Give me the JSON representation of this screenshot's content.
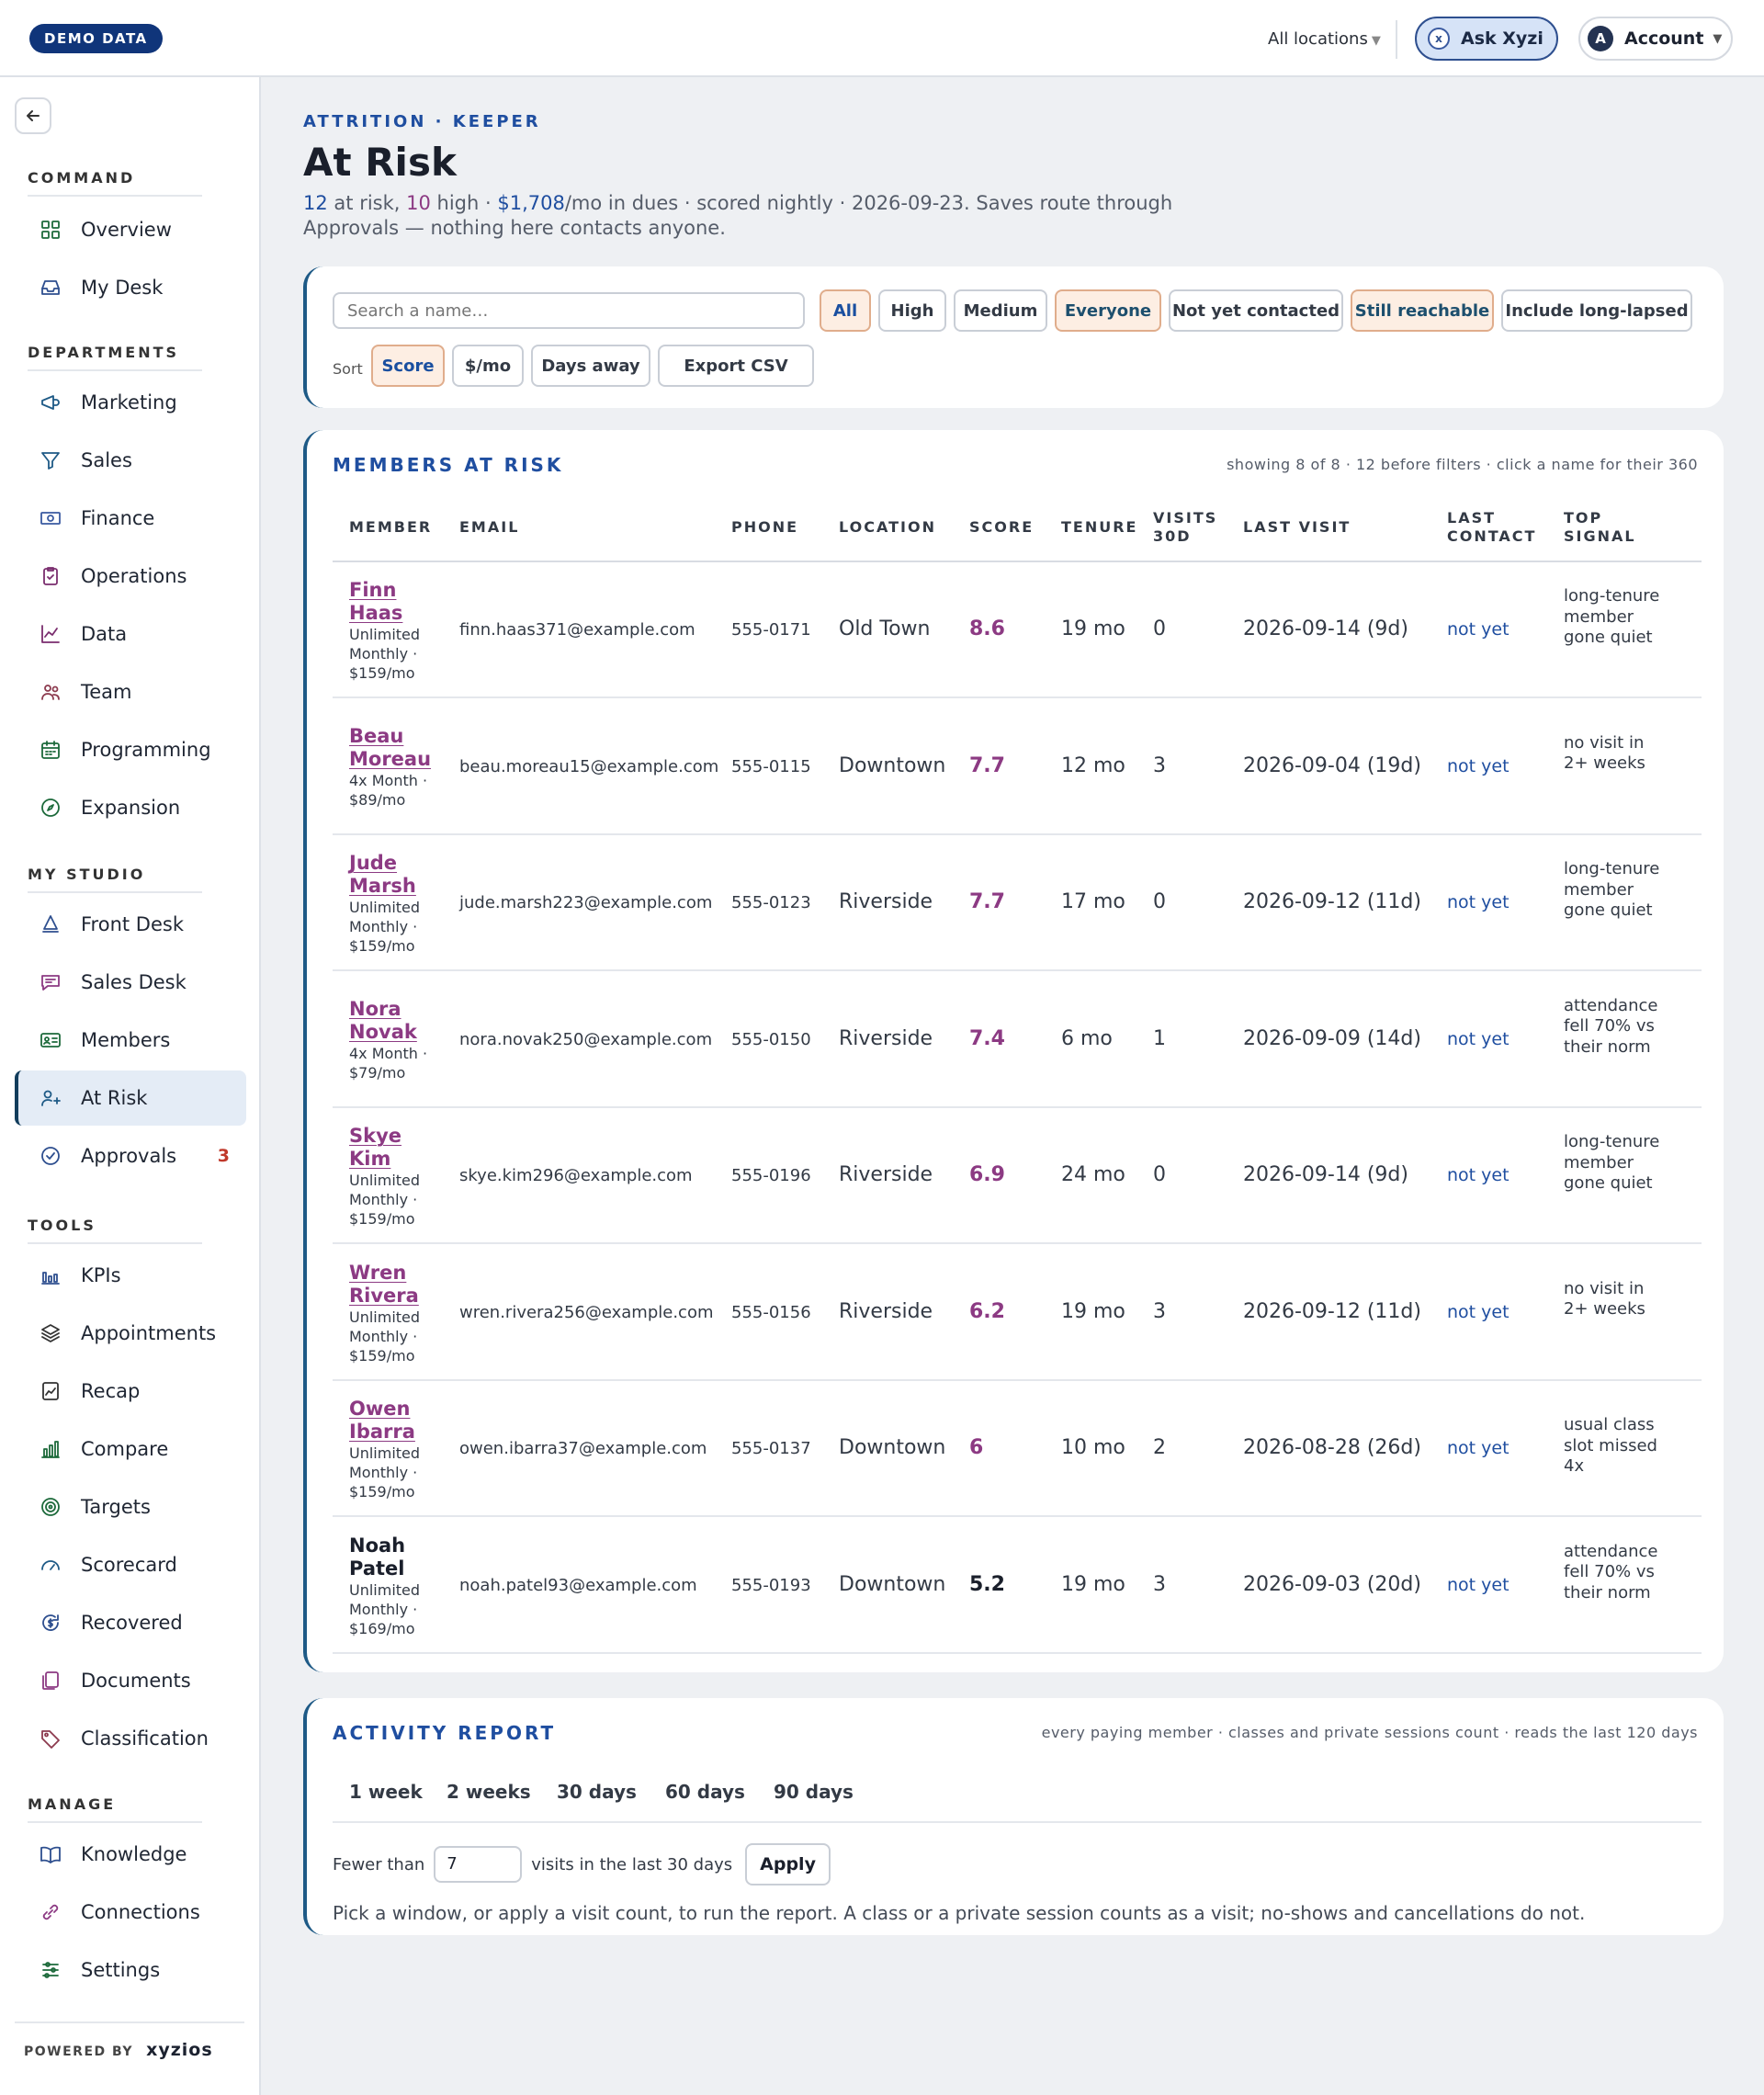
{
  "topbar": {
    "demo_badge": "DEMO DATA",
    "location_select": "All locations",
    "ask_label": "Ask Xyzi",
    "account_initial": "A",
    "account_label": "Account"
  },
  "sidebar": {
    "sections": [
      {
        "label": "COMMAND",
        "items": [
          {
            "label": "Overview",
            "icon": "grid-icon"
          },
          {
            "label": "My Desk",
            "icon": "inbox-icon"
          }
        ]
      },
      {
        "label": "DEPARTMENTS",
        "items": [
          {
            "label": "Marketing",
            "icon": "megaphone-icon"
          },
          {
            "label": "Sales",
            "icon": "funnel-icon"
          },
          {
            "label": "Finance",
            "icon": "banknote-icon"
          },
          {
            "label": "Operations",
            "icon": "clipboard-check-icon"
          },
          {
            "label": "Data",
            "icon": "line-chart-icon"
          },
          {
            "label": "Team",
            "icon": "users-icon"
          },
          {
            "label": "Programming",
            "icon": "calendar-icon"
          },
          {
            "label": "Expansion",
            "icon": "compass-icon"
          }
        ]
      },
      {
        "label": "MY STUDIO",
        "items": [
          {
            "label": "Front Desk",
            "icon": "bell-icon"
          },
          {
            "label": "Sales Desk",
            "icon": "message-icon"
          },
          {
            "label": "Members",
            "icon": "id-card-icon"
          },
          {
            "label": "At Risk",
            "icon": "user-alert-icon",
            "active": true
          },
          {
            "label": "Approvals",
            "icon": "check-circle-icon",
            "badge": "3"
          }
        ]
      },
      {
        "label": "TOOLS",
        "items": [
          {
            "label": "KPIs",
            "icon": "bar-chart-icon"
          },
          {
            "label": "Appointments",
            "icon": "layers-icon"
          },
          {
            "label": "Recap",
            "icon": "trend-doc-icon"
          },
          {
            "label": "Compare",
            "icon": "columns-chart-icon"
          },
          {
            "label": "Targets",
            "icon": "target-icon"
          },
          {
            "label": "Scorecard",
            "icon": "gauge-icon"
          },
          {
            "label": "Recovered",
            "icon": "refresh-dollar-icon"
          },
          {
            "label": "Documents",
            "icon": "documents-icon"
          },
          {
            "label": "Classification",
            "icon": "tag-icon"
          }
        ]
      },
      {
        "label": "MANAGE",
        "items": [
          {
            "label": "Knowledge",
            "icon": "book-icon"
          },
          {
            "label": "Connections",
            "icon": "link-icon"
          },
          {
            "label": "Settings",
            "icon": "sliders-icon"
          }
        ]
      }
    ],
    "powered_by": "POWERED BY",
    "brand": "xyzios"
  },
  "page": {
    "eyebrow": "ATTRITION · KEEPER",
    "title": "At Risk",
    "summary": {
      "at_risk": "12",
      "at_risk_text": " at risk, ",
      "high": "10",
      "high_text": " high · ",
      "dues": "$1,708",
      "rest": "/mo in dues · scored nightly · 2026-09-23. Saves route through Approvals — nothing here contacts anyone."
    }
  },
  "filters": {
    "search_placeholder": "Search a name…",
    "chips": [
      "All",
      "High",
      "Medium",
      "Everyone",
      "Not yet contacted",
      "Still reachable",
      "Include long-lapsed"
    ],
    "sort_label": "Sort",
    "sort_chips": [
      "Score",
      "$/mo",
      "Days away"
    ],
    "export_label": "Export CSV"
  },
  "members_table": {
    "title": "MEMBERS AT RISK",
    "note": "showing 8 of 8 · 12 before filters · click a name for their 360",
    "headers": {
      "member": "MEMBER",
      "email": "EMAIL",
      "phone": "PHONE",
      "location": "LOCATION",
      "score": "SCORE",
      "tenure": "TENURE",
      "visits_1": "VISITS",
      "visits_2": "30D",
      "last_visit": "LAST VISIT",
      "last_contact_1": "LAST",
      "last_contact_2": "CONTACT",
      "signal_1": "TOP",
      "signal_2": "SIGNAL"
    },
    "rows": [
      {
        "first": "Finn",
        "last": "Haas",
        "plan": "Unlimited Monthly · $159/mo",
        "email": "finn.haas371@example.com",
        "phone": "555-0171",
        "location": "Old Town",
        "score": "8.6",
        "tenure": "19 mo",
        "visits": "0",
        "last_visit": "2026-09-14 (9d)",
        "contact": "not yet",
        "signal": "long-tenure member gone quiet"
      },
      {
        "first": "Beau",
        "last": "Moreau",
        "plan": "4x Month · $89/mo",
        "email": "beau.moreau15@example.com",
        "phone": "555-0115",
        "location": "Downtown",
        "score": "7.7",
        "tenure": "12 mo",
        "visits": "3",
        "last_visit": "2026-09-04 (19d)",
        "contact": "not yet",
        "signal": "no visit in 2+ weeks"
      },
      {
        "first": "Jude",
        "last": "Marsh",
        "plan": "Unlimited Monthly · $159/mo",
        "email": "jude.marsh223@example.com",
        "phone": "555-0123",
        "location": "Riverside",
        "score": "7.7",
        "tenure": "17 mo",
        "visits": "0",
        "last_visit": "2026-09-12 (11d)",
        "contact": "not yet",
        "signal": "long-tenure member gone quiet"
      },
      {
        "first": "Nora",
        "last": "Novak",
        "plan": "4x Month · $79/mo",
        "email": "nora.novak250@example.com",
        "phone": "555-0150",
        "location": "Riverside",
        "score": "7.4",
        "tenure": "6 mo",
        "visits": "1",
        "last_visit": "2026-09-09 (14d)",
        "contact": "not yet",
        "signal": "attendance fell 70% vs their norm"
      },
      {
        "first": "Skye",
        "last": "Kim",
        "plan": "Unlimited Monthly · $159/mo",
        "email": "skye.kim296@example.com",
        "phone": "555-0196",
        "location": "Riverside",
        "score": "6.9",
        "tenure": "24 mo",
        "visits": "0",
        "last_visit": "2026-09-14 (9d)",
        "contact": "not yet",
        "signal": "long-tenure member gone quiet"
      },
      {
        "first": "Wren",
        "last": "Rivera",
        "plan": "Unlimited Monthly · $159/mo",
        "email": "wren.rivera256@example.com",
        "phone": "555-0156",
        "location": "Riverside",
        "score": "6.2",
        "tenure": "19 mo",
        "visits": "3",
        "last_visit": "2026-09-12 (11d)",
        "contact": "not yet",
        "signal": "no visit in 2+ weeks"
      },
      {
        "first": "Owen",
        "last": "Ibarra",
        "plan": "Unlimited Monthly · $159/mo",
        "email": "owen.ibarra37@example.com",
        "phone": "555-0137",
        "location": "Downtown",
        "score": "6",
        "tenure": "10 mo",
        "visits": "2",
        "last_visit": "2026-08-28 (26d)",
        "contact": "not yet",
        "signal": "usual class slot missed 4x"
      },
      {
        "first": "Noah",
        "last": "Patel",
        "plan": "Unlimited Monthly · $169/mo",
        "email": "noah.patel93@example.com",
        "phone": "555-0193",
        "location": "Downtown",
        "score": "5.2",
        "tenure": "19 mo",
        "visits": "3",
        "last_visit": "2026-09-03 (20d)",
        "contact": "not yet",
        "signal": "attendance fell 70% vs their norm",
        "plain": true
      }
    ]
  },
  "activity": {
    "title": "ACTIVITY REPORT",
    "note": "every paying member · classes and private sessions count · reads the last 120 days",
    "tabs": [
      "1 week",
      "2 weeks",
      "30 days",
      "60 days",
      "90 days"
    ],
    "fewer_label": "Fewer than",
    "fewer_value": "7",
    "visits_label": "visits in the last 30 days",
    "apply_label": "Apply",
    "help": "Pick a window, or apply a visit count, to run the report. A class or a private session counts as a visit; no-shows and cancellations do not."
  }
}
